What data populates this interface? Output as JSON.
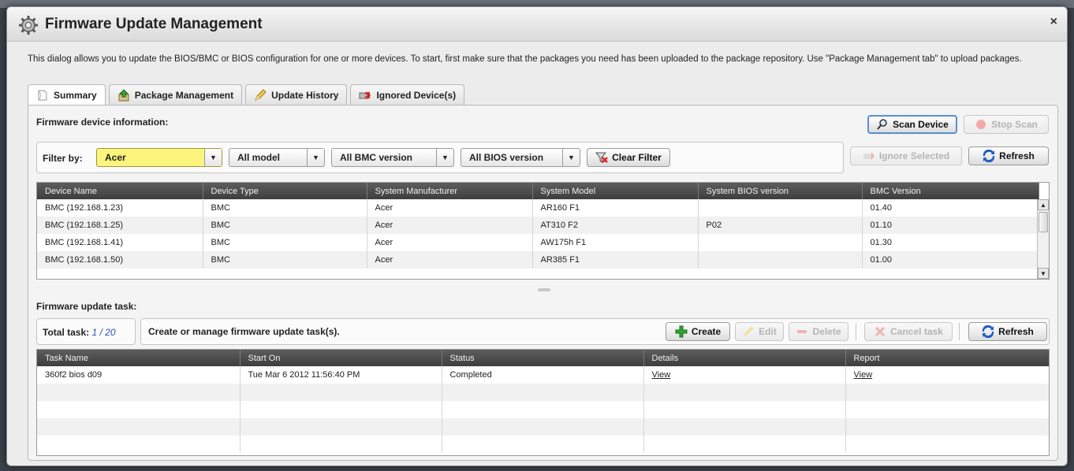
{
  "dialog": {
    "title": "Firmware Update Management",
    "close_symbol": "×",
    "intro": "This dialog allows you to update the BIOS/BMC or BIOS configuration for one or more devices.  To start, first make sure that the packages you need has been uploaded to the package repository. Use \"Package Management tab\" to upload packages."
  },
  "tabs": [
    {
      "label": "Summary",
      "icon": "document-icon"
    },
    {
      "label": "Package Management",
      "icon": "package-icon"
    },
    {
      "label": "Update History",
      "icon": "pencil-icon"
    },
    {
      "label": "Ignored Device(s)",
      "icon": "ignore-icon"
    }
  ],
  "device_section": {
    "title": "Firmware device information:",
    "scan_label": "Scan Device",
    "stop_scan_label": "Stop Scan",
    "filter_label": "Filter by:",
    "filters": {
      "manufacturer": "Acer",
      "model": "All model",
      "bmc_version": "All BMC version",
      "bios_version": "All BIOS version"
    },
    "clear_filter_label": "Clear Filter",
    "ignore_selected_label": "Ignore Selected",
    "refresh_label": "Refresh",
    "columns": [
      "Device Name",
      "Device Type",
      "System Manufacturer",
      "System Model",
      "System BIOS version",
      "BMC Version"
    ],
    "rows": [
      [
        "BMC (192.168.1.23)",
        "BMC",
        "Acer",
        "AR160 F1",
        "",
        "01.40"
      ],
      [
        "BMC (192.168.1.25)",
        "BMC",
        "Acer",
        "AT310 F2",
        "P02",
        "01.10"
      ],
      [
        "BMC (192.168.1.41)",
        "BMC",
        "Acer",
        "AW175h F1",
        "",
        "01.30"
      ],
      [
        "BMC (192.168.1.50)",
        "BMC",
        "Acer",
        "AR385 F1",
        "",
        "01.00"
      ]
    ]
  },
  "task_section": {
    "title": "Firmware update task:",
    "total_label": "Total task:",
    "total_value": "1 / 20",
    "description": "Create or manage firmware update task(s).",
    "create_label": "Create",
    "edit_label": "Edit",
    "delete_label": "Delete",
    "cancel_task_label": "Cancel task",
    "refresh_label": "Refresh",
    "columns": [
      "Task Name",
      "Start On",
      "Status",
      "Details",
      "Report"
    ],
    "rows": [
      [
        "360f2 bios d09",
        "Tue Mar 6 2012 11:56:40 PM",
        "Completed",
        "View",
        "View"
      ]
    ]
  },
  "colors": {
    "filter_highlight": "#fbf57d",
    "header_dark": "#4a4a4a",
    "link_blue": "#2a4fb8"
  }
}
